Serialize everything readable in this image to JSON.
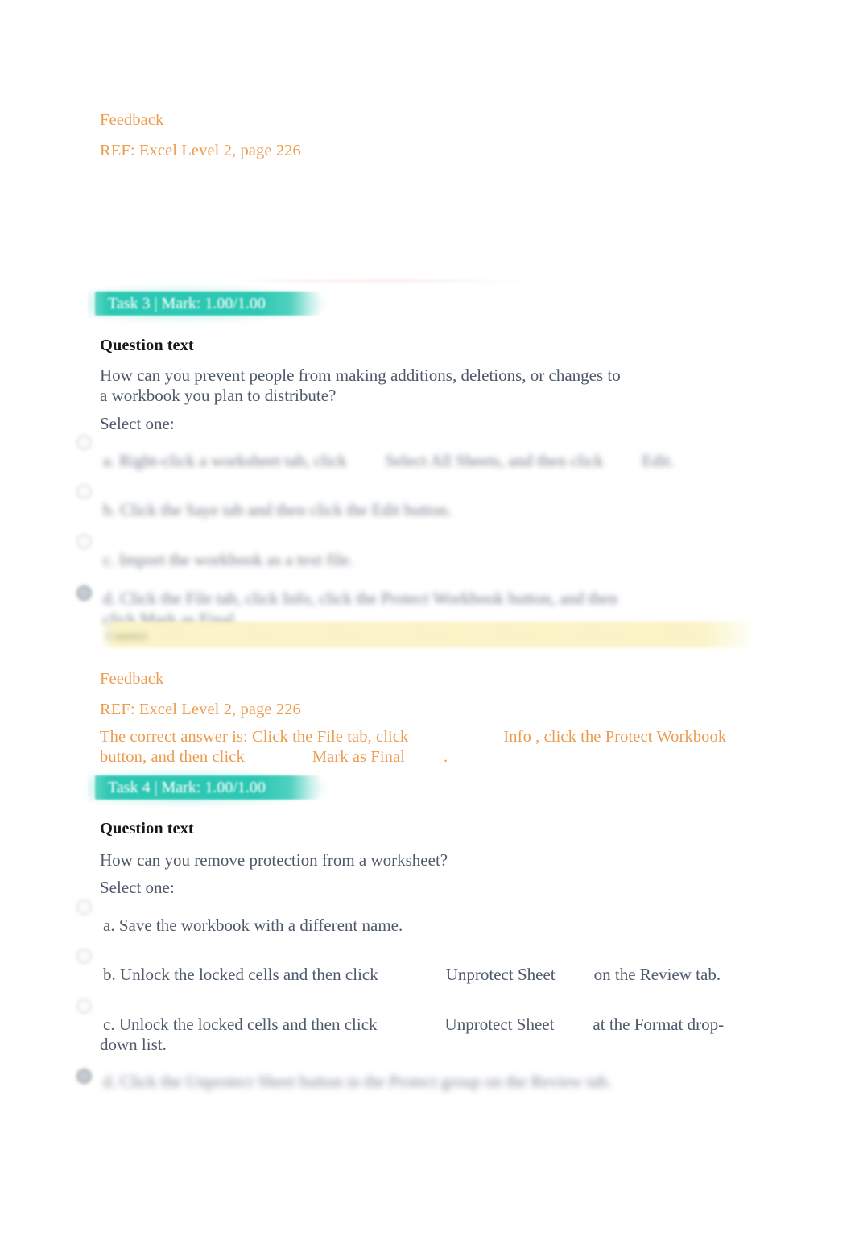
{
  "page": {
    "top_feedback": {
      "label": "Feedback",
      "ref": "REF: Excel Level 2, page 226"
    }
  },
  "tasks": [
    {
      "badge": "Task 3 | Mark: 1.00/1.00",
      "question_label": "Question text",
      "question_line1": "How can you prevent people from making additions, deletions, or changes to",
      "question_line2": "a workbook you plan to distribute?",
      "select_one": "Select one:",
      "options": [
        {
          "key": "a",
          "text_pre": "a. Right-click a worksheet tab, click",
          "text_mid": "Select All Sheets",
          "text_post": ", and then click",
          "text_end": "Edit",
          "tail": ".",
          "selected": false,
          "blurred": true
        },
        {
          "key": "b",
          "text_pre": "b. Click the Saye tab and then click the Edit button.",
          "text_mid": "",
          "text_post": "",
          "text_end": "",
          "tail": "",
          "selected": false,
          "blurred": true
        },
        {
          "key": "c",
          "text_pre": "c. Import the workbook as a text file.",
          "text_mid": "",
          "text_post": "",
          "text_end": "",
          "tail": "",
          "selected": false,
          "blurred": true
        },
        {
          "key": "d",
          "text_pre": "d. Click the File tab, click Info, click the Protect Workbook button, and then",
          "text_mid": "click Mark as Final.",
          "text_post": "",
          "text_end": "",
          "tail": "",
          "selected": true,
          "blurred": true
        }
      ],
      "correct_strip_label": "Correct",
      "feedback": {
        "label": "Feedback",
        "ref": "REF: Excel Level 2, page 226",
        "answer_line1_a": "The correct answer is: Click the File tab, click",
        "answer_line1_b": "Info , click the Protect Workbook",
        "answer_line2_a": "button, and then click",
        "answer_line2_b": "Mark as Final",
        "answer_line2_c": "."
      }
    },
    {
      "badge": "Task 4 | Mark: 1.00/1.00",
      "question_label": "Question text",
      "question_line1": "How can you remove protection from a worksheet?",
      "question_line2": "",
      "select_one": "Select one:",
      "options": [
        {
          "key": "a",
          "text_pre": "a. Save the workbook with a different name.",
          "text_mid": "",
          "text_post": "",
          "text_end": "",
          "tail": "",
          "selected": false,
          "blurred": false
        },
        {
          "key": "b",
          "text_pre": "b. Unlock the locked cells and then click",
          "text_mid": "Unprotect Sheet",
          "text_post": "on the Review tab.",
          "text_end": "",
          "tail": "",
          "selected": false,
          "blurred": false
        },
        {
          "key": "c",
          "text_pre": "c. Unlock the locked cells and then click",
          "text_mid": "Unprotect Sheet",
          "text_post": "at the Format drop-",
          "text_end": "down list.",
          "tail": "",
          "selected": false,
          "blurred": false
        },
        {
          "key": "d",
          "text_pre": "d. Click the Unprotect Sheet button in the Protect group on the Review tab.",
          "text_mid": "",
          "text_post": "",
          "text_end": "",
          "tail": "",
          "selected": true,
          "blurred": true
        }
      ]
    }
  ],
  "colors": {
    "feedback_orange": "#ed9b4e",
    "badge_teal": "#20c4ae",
    "question_slate": "#4e5a6b",
    "correct_yellow": "#faf3c4"
  }
}
